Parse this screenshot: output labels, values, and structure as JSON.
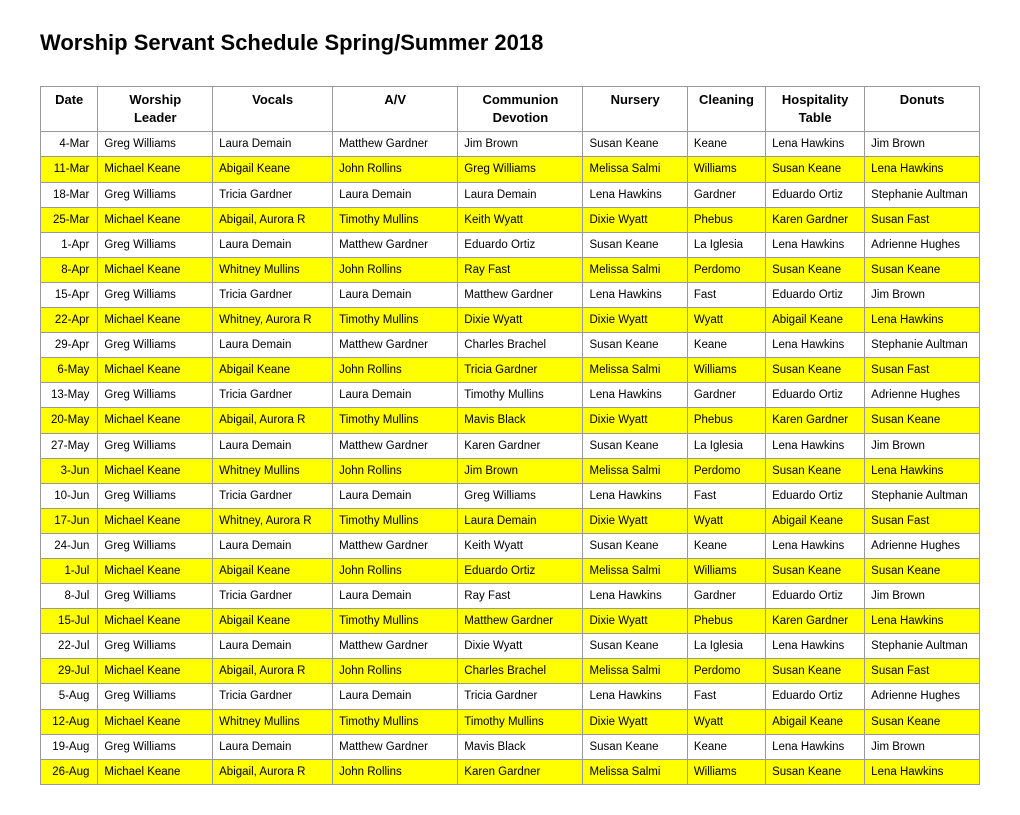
{
  "title": "Worship Servant Schedule Spring/Summer 2018",
  "headers": {
    "date": "Date",
    "worship": "Worship\nLeader",
    "vocals": "Vocals",
    "av": "A/V",
    "communion": "Communion\nDevotion",
    "nursery": "Nursery",
    "cleaning": "Cleaning",
    "hospitality": "Hospitality\nTable",
    "donuts": "Donuts"
  },
  "rows": [
    {
      "date": "4-Mar",
      "hl": false,
      "worship": "Greg Williams",
      "vocals": "Laura Demain",
      "av": "Matthew Gardner",
      "communion": "Jim Brown",
      "nursery": "Susan Keane",
      "cleaning": "Keane",
      "hospitality": "Lena Hawkins",
      "donuts": "Jim Brown"
    },
    {
      "date": "11-Mar",
      "hl": true,
      "worship": "Michael Keane",
      "vocals": "Abigail Keane",
      "av": "John Rollins",
      "communion": "Greg Williams",
      "nursery": "Melissa Salmi",
      "cleaning": "Williams",
      "hospitality": "Susan Keane",
      "donuts": "Lena Hawkins"
    },
    {
      "date": "18-Mar",
      "hl": false,
      "worship": "Greg Williams",
      "vocals": "Tricia Gardner",
      "av": "Laura Demain",
      "communion": "Laura Demain",
      "nursery": "Lena Hawkins",
      "cleaning": "Gardner",
      "hospitality": "Eduardo Ortiz",
      "donuts": "Stephanie Aultman"
    },
    {
      "date": "25-Mar",
      "hl": true,
      "worship": "Michael Keane",
      "vocals": "Abigail, Aurora R",
      "av": "Timothy Mullins",
      "communion": "Keith Wyatt",
      "nursery": "Dixie Wyatt",
      "cleaning": "Phebus",
      "hospitality": "Karen Gardner",
      "donuts": "Susan Fast"
    },
    {
      "date": "1-Apr",
      "hl": false,
      "worship": "Greg Williams",
      "vocals": "Laura Demain",
      "av": "Matthew Gardner",
      "communion": "Eduardo Ortiz",
      "nursery": "Susan Keane",
      "cleaning": "La Iglesia",
      "hospitality": "Lena Hawkins",
      "donuts": "Adrienne Hughes"
    },
    {
      "date": "8-Apr",
      "hl": true,
      "worship": "Michael Keane",
      "vocals": "Whitney Mullins",
      "av": "John Rollins",
      "communion": "Ray Fast",
      "nursery": "Melissa Salmi",
      "cleaning": "Perdomo",
      "hospitality": "Susan Keane",
      "donuts": "Susan Keane"
    },
    {
      "date": "15-Apr",
      "hl": false,
      "worship": "Greg Williams",
      "vocals": "Tricia Gardner",
      "av": "Laura Demain",
      "communion": "Matthew Gardner",
      "nursery": "Lena Hawkins",
      "cleaning": "Fast",
      "hospitality": "Eduardo Ortiz",
      "donuts": "Jim Brown"
    },
    {
      "date": "22-Apr",
      "hl": true,
      "worship": "Michael Keane",
      "vocals": "Whitney, Aurora R",
      "av": "Timothy Mullins",
      "communion": "Dixie Wyatt",
      "nursery": "Dixie Wyatt",
      "cleaning": "Wyatt",
      "hospitality": "Abigail Keane",
      "donuts": "Lena Hawkins"
    },
    {
      "date": "29-Apr",
      "hl": false,
      "worship": "Greg Williams",
      "vocals": "Laura Demain",
      "av": "Matthew Gardner",
      "communion": "Charles Brachel",
      "nursery": "Susan Keane",
      "cleaning": "Keane",
      "hospitality": "Lena Hawkins",
      "donuts": "Stephanie Aultman"
    },
    {
      "date": "6-May",
      "hl": true,
      "worship": "Michael Keane",
      "vocals": "Abigail Keane",
      "av": "John Rollins",
      "communion": "Tricia Gardner",
      "nursery": "Melissa Salmi",
      "cleaning": "Williams",
      "hospitality": "Susan Keane",
      "donuts": "Susan Fast"
    },
    {
      "date": "13-May",
      "hl": false,
      "worship": "Greg Williams",
      "vocals": "Tricia Gardner",
      "av": "Laura Demain",
      "communion": "Timothy Mullins",
      "nursery": "Lena Hawkins",
      "cleaning": "Gardner",
      "hospitality": "Eduardo Ortiz",
      "donuts": "Adrienne Hughes"
    },
    {
      "date": "20-May",
      "hl": true,
      "worship": "Michael Keane",
      "vocals": "Abigail, Aurora R",
      "av": "Timothy Mullins",
      "communion": "Mavis Black",
      "nursery": "Dixie Wyatt",
      "cleaning": "Phebus",
      "hospitality": "Karen Gardner",
      "donuts": "Susan Keane"
    },
    {
      "date": "27-May",
      "hl": false,
      "worship": "Greg Williams",
      "vocals": "Laura Demain",
      "av": "Matthew Gardner",
      "communion": "Karen Gardner",
      "nursery": "Susan Keane",
      "cleaning": "La Iglesia",
      "hospitality": "Lena Hawkins",
      "donuts": "Jim Brown"
    },
    {
      "date": "3-Jun",
      "hl": true,
      "worship": "Michael Keane",
      "vocals": "Whitney Mullins",
      "av": "John Rollins",
      "communion": "Jim Brown",
      "nursery": "Melissa Salmi",
      "cleaning": "Perdomo",
      "hospitality": "Susan Keane",
      "donuts": "Lena Hawkins"
    },
    {
      "date": "10-Jun",
      "hl": false,
      "worship": "Greg Williams",
      "vocals": "Tricia Gardner",
      "av": "Laura Demain",
      "communion": "Greg Williams",
      "nursery": "Lena Hawkins",
      "cleaning": "Fast",
      "hospitality": "Eduardo Ortiz",
      "donuts": "Stephanie Aultman"
    },
    {
      "date": "17-Jun",
      "hl": true,
      "worship": "Michael Keane",
      "vocals": "Whitney, Aurora R",
      "av": "Timothy Mullins",
      "communion": "Laura Demain",
      "nursery": "Dixie Wyatt",
      "cleaning": "Wyatt",
      "hospitality": "Abigail Keane",
      "donuts": "Susan Fast"
    },
    {
      "date": "24-Jun",
      "hl": false,
      "worship": "Greg Williams",
      "vocals": "Laura Demain",
      "av": "Matthew Gardner",
      "communion": "Keith Wyatt",
      "nursery": "Susan Keane",
      "cleaning": "Keane",
      "hospitality": "Lena Hawkins",
      "donuts": "Adrienne Hughes"
    },
    {
      "date": "1-Jul",
      "hl": true,
      "worship": "Michael Keane",
      "vocals": "Abigail Keane",
      "av": "John Rollins",
      "communion": "Eduardo Ortiz",
      "nursery": "Melissa Salmi",
      "cleaning": "Williams",
      "hospitality": "Susan Keane",
      "donuts": "Susan Keane"
    },
    {
      "date": "8-Jul",
      "hl": false,
      "worship": "Greg Williams",
      "vocals": "Tricia Gardner",
      "av": "Laura Demain",
      "communion": "Ray Fast",
      "nursery": "Lena Hawkins",
      "cleaning": "Gardner",
      "hospitality": "Eduardo Ortiz",
      "donuts": "Jim Brown"
    },
    {
      "date": "15-Jul",
      "hl": true,
      "worship": "Michael Keane",
      "vocals": "Abigail Keane",
      "av": "Timothy Mullins",
      "communion": "Matthew Gardner",
      "nursery": "Dixie Wyatt",
      "cleaning": "Phebus",
      "hospitality": "Karen Gardner",
      "donuts": "Lena Hawkins"
    },
    {
      "date": "22-Jul",
      "hl": false,
      "worship": "Greg Williams",
      "vocals": "Laura Demain",
      "av": "Matthew Gardner",
      "communion": "Dixie Wyatt",
      "nursery": "Susan Keane",
      "cleaning": "La Iglesia",
      "hospitality": "Lena Hawkins",
      "donuts": "Stephanie Aultman"
    },
    {
      "date": "29-Jul",
      "hl": true,
      "worship": "Michael Keane",
      "vocals": "Abigail, Aurora R",
      "av": "John Rollins",
      "communion": "Charles Brachel",
      "nursery": "Melissa Salmi",
      "cleaning": "Perdomo",
      "hospitality": "Susan Keane",
      "donuts": "Susan Fast"
    },
    {
      "date": "5-Aug",
      "hl": false,
      "worship": "Greg Williams",
      "vocals": "Tricia Gardner",
      "av": "Laura Demain",
      "communion": "Tricia Gardner",
      "nursery": "Lena Hawkins",
      "cleaning": "Fast",
      "hospitality": "Eduardo Ortiz",
      "donuts": "Adrienne Hughes"
    },
    {
      "date": "12-Aug",
      "hl": true,
      "worship": "Michael Keane",
      "vocals": "Whitney Mullins",
      "av": "Timothy Mullins",
      "communion": "Timothy Mullins",
      "nursery": "Dixie Wyatt",
      "cleaning": "Wyatt",
      "hospitality": "Abigail Keane",
      "donuts": "Susan Keane"
    },
    {
      "date": "19-Aug",
      "hl": false,
      "worship": "Greg Williams",
      "vocals": "Laura Demain",
      "av": "Matthew Gardner",
      "communion": "Mavis Black",
      "nursery": "Susan Keane",
      "cleaning": "Keane",
      "hospitality": "Lena Hawkins",
      "donuts": "Jim Brown"
    },
    {
      "date": "26-Aug",
      "hl": true,
      "worship": "Michael Keane",
      "vocals": "Abigail, Aurora R",
      "av": "John Rollins",
      "communion": "Karen Gardner",
      "nursery": "Melissa Salmi",
      "cleaning": "Williams",
      "hospitality": "Susan Keane",
      "donuts": "Lena Hawkins"
    }
  ]
}
